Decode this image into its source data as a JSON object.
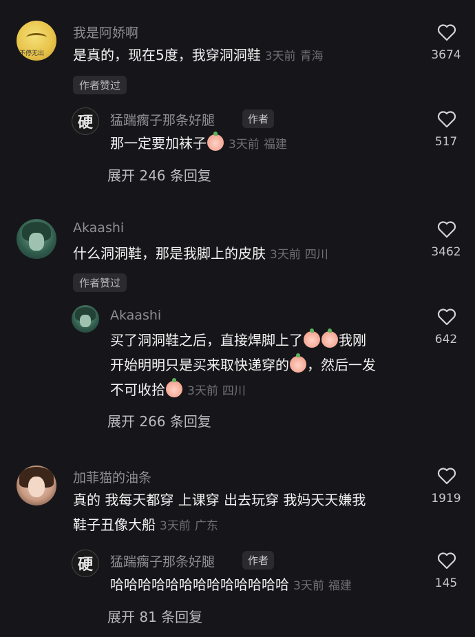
{
  "comments": [
    {
      "name": "我是阿娇啊",
      "text": "是真的，现在5度，我穿洞洞鞋",
      "time": "3天前",
      "location": "青海",
      "likes": "3674",
      "badge": "作者赞过",
      "avatar_text": "不停无出",
      "reply": {
        "name": "猛踹瘸子那条好腿",
        "tag": "作者",
        "text": "那一定要加袜子",
        "time": "3天前",
        "location": "福建",
        "likes": "517",
        "avatar_char": "硬"
      },
      "expand": "展开 246 条回复"
    },
    {
      "name": "Akaashi",
      "text": "什么洞洞鞋，那是我脚上的皮肤",
      "time": "3天前",
      "location": "四川",
      "likes": "3462",
      "badge": "作者赞过",
      "reply": {
        "name": "Akaashi",
        "line1": "买了洞洞鞋之后，直接焊脚上了",
        "line1_tail": "我刚",
        "line2": "开始明明只是买来取快递穿的",
        "line2_tail": "，然后一发",
        "line3": "不可收拾",
        "time": "3天前",
        "location": "四川",
        "likes": "642"
      },
      "expand": "展开 266 条回复"
    },
    {
      "name": "加菲猫的油条",
      "line1": "真的 我每天都穿 上课穿 出去玩穿 我妈天天嫌我",
      "line2": "鞋子丑像大船",
      "time": "3天前",
      "location": "广东",
      "likes": "1919",
      "reply": {
        "name": "猛踹瘸子那条好腿",
        "tag": "作者",
        "text": "哈哈哈哈哈哈哈哈哈哈哈哈哈",
        "time": "3天前",
        "location": "福建",
        "likes": "145",
        "avatar_char": "硬"
      },
      "expand": "展开 81 条回复"
    }
  ],
  "icons": {
    "like": "heart-outline-icon",
    "emoji": "peach-face-emoji"
  }
}
